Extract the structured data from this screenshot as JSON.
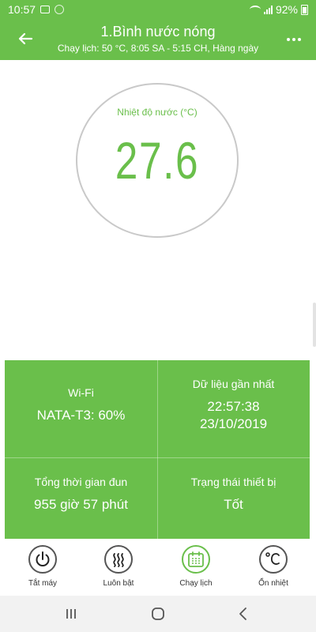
{
  "status_bar": {
    "time": "10:57",
    "battery": "92%"
  },
  "header": {
    "title": "1.Bình nước nóng",
    "subtitle": "Chạy lịch: 50 °C, 8:05 SA - 5:15 CH, Hàng ngày",
    "back_icon": "arrow-left-icon",
    "menu_icon": "more-dots-icon"
  },
  "gauge": {
    "label": "Nhiệt độ nước (°C)",
    "value": "27.6"
  },
  "info": {
    "wifi": {
      "label": "Wi-Fi",
      "value": "NATA-T3: 60%"
    },
    "last_data": {
      "label": "Dữ liệu gần nhất",
      "time": "22:57:38",
      "date": "23/10/2019"
    },
    "total_time": {
      "label": "Tổng thời gian đun",
      "value": "955 giờ 57 phút"
    },
    "device_status": {
      "label": "Trạng thái thiết bị",
      "value": "Tốt"
    }
  },
  "modes": [
    {
      "label": "Tắt máy",
      "icon": "power-icon"
    },
    {
      "label": "Luôn bật",
      "icon": "heat-waves-icon"
    },
    {
      "label": "Chạy lịch",
      "icon": "calendar-icon"
    },
    {
      "label": "Ổn nhiệt",
      "icon": "celsius-icon"
    }
  ],
  "colors": {
    "primary": "#6abf4b",
    "gauge_border": "#c9c9c9",
    "nav_bg": "#f2f2f2"
  }
}
